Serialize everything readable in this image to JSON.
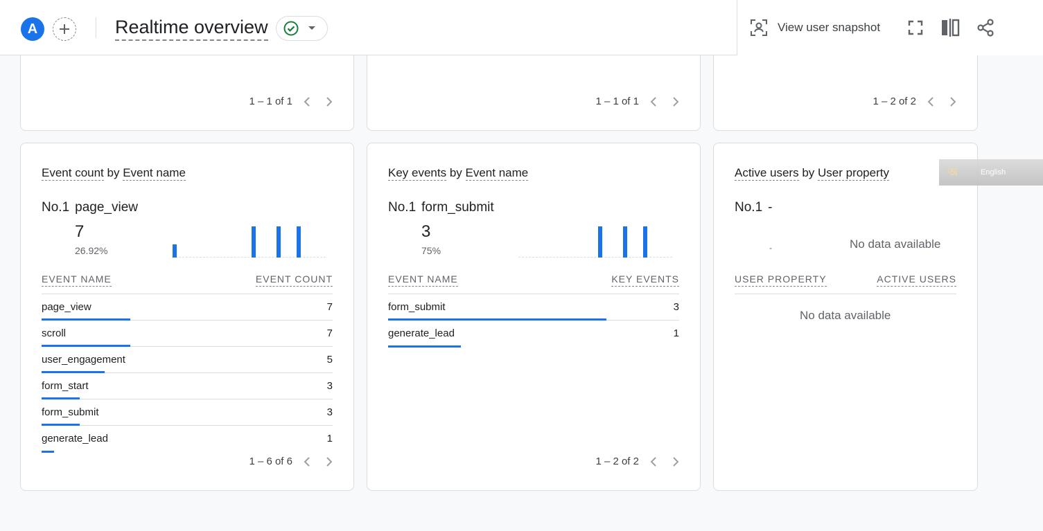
{
  "header": {
    "avatar_letter": "A",
    "add_label": "+",
    "title": "Realtime overview",
    "status_icon": "check-circle-icon",
    "snapshot_label": "View user snapshot",
    "icons": [
      "person-snapshot-icon",
      "fullscreen-icon",
      "compare-icon",
      "share-icon"
    ]
  },
  "top_cards": [
    {
      "pager": "1 – 1 of 1"
    },
    {
      "pager": "1 – 1 of 1"
    },
    {
      "pager": "1 – 2 of 2"
    }
  ],
  "event_count": {
    "title_a": "Event count",
    "title_by": " by ",
    "title_b": "Event name",
    "rank": "No.1",
    "top_name": "page_view",
    "top_value": "7",
    "top_pct": "26.92%",
    "sparkline": [
      3,
      0,
      0,
      0,
      0,
      0,
      0,
      0,
      0,
      0,
      0,
      0,
      0,
      0,
      0,
      0,
      7,
      0,
      0,
      0,
      0,
      7,
      0,
      0,
      0,
      7,
      0,
      0,
      0,
      0,
      0
    ],
    "col_name": "EVENT NAME",
    "col_value": "EVENT COUNT",
    "rows": [
      {
        "name": "page_view",
        "value": "7"
      },
      {
        "name": "scroll",
        "value": "7"
      },
      {
        "name": "user_engagement",
        "value": "5"
      },
      {
        "name": "form_start",
        "value": "3"
      },
      {
        "name": "form_submit",
        "value": "3"
      },
      {
        "name": "generate_lead",
        "value": "1"
      }
    ],
    "pager": "1 – 6 of 6"
  },
  "key_events": {
    "title_a": "Key events",
    "title_by": " by ",
    "title_b": "Event name",
    "rank": "No.1",
    "top_name": "form_submit",
    "top_value": "3",
    "top_pct": "75%",
    "sparkline": [
      0,
      0,
      0,
      0,
      0,
      0,
      0,
      0,
      0,
      0,
      0,
      0,
      0,
      0,
      0,
      0,
      3,
      0,
      0,
      0,
      0,
      3,
      0,
      0,
      0,
      3,
      0,
      0,
      0,
      0,
      0
    ],
    "col_name": "EVENT NAME",
    "col_value": "KEY EVENTS",
    "rows": [
      {
        "name": "form_submit",
        "value": "3"
      },
      {
        "name": "generate_lead",
        "value": "1"
      }
    ],
    "pager": "1 – 2 of 2"
  },
  "active_users": {
    "title_a": "Active users",
    "title_by": " by ",
    "title_b": "User property",
    "rank": "No.1",
    "top_name": "-",
    "dash_value": "-",
    "no_data_chart": "No data available",
    "col_name": "USER PROPERTY",
    "col_value": "ACTIVE USERS",
    "no_data_table": "No data available"
  },
  "language_widget": {
    "label": "English"
  },
  "colors": {
    "accent": "#1a73e8",
    "border": "#dadce0",
    "status_green": "#188038"
  }
}
